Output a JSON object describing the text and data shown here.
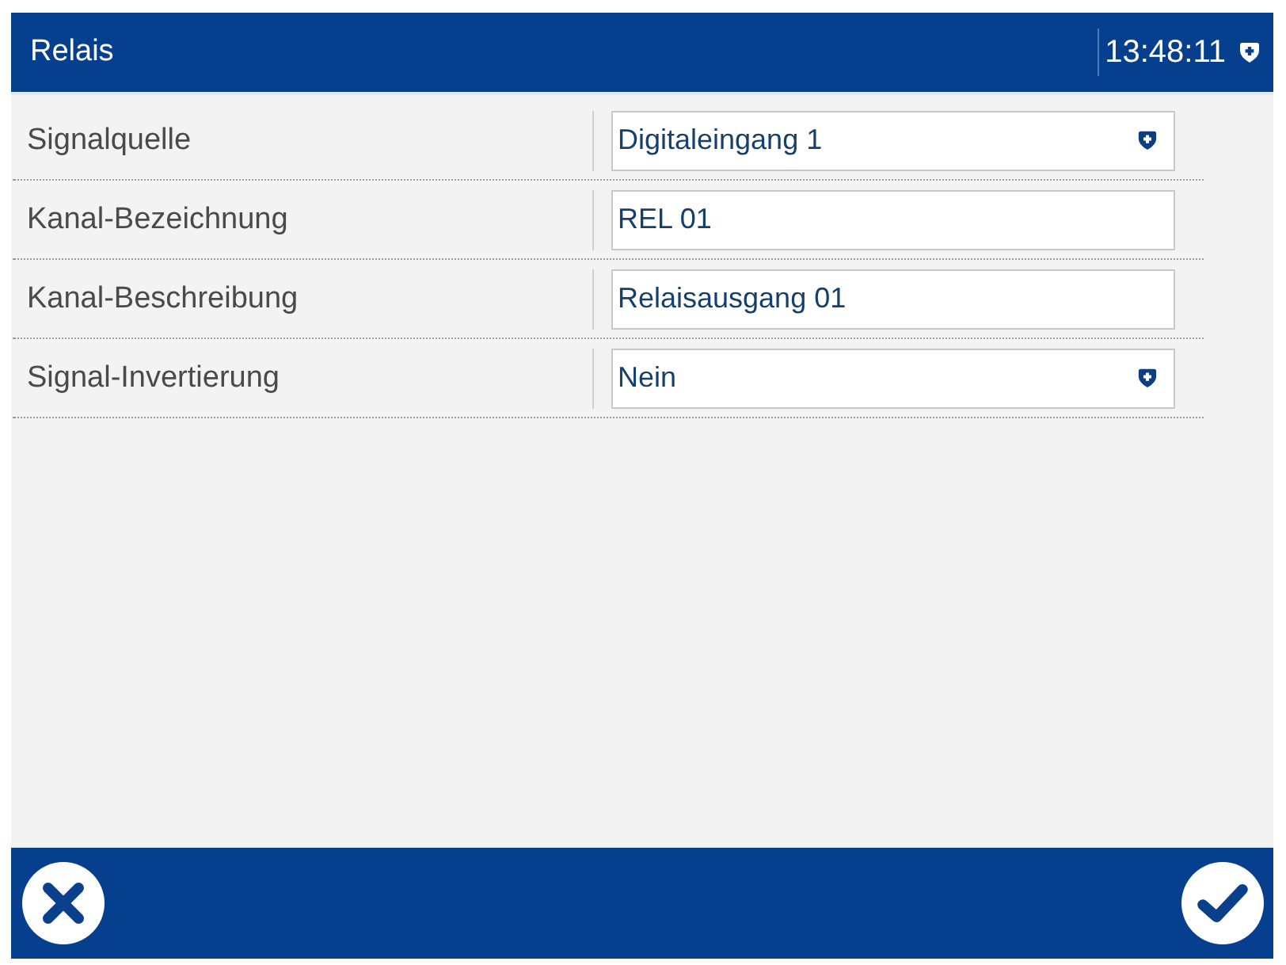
{
  "window": {
    "title": "Relais",
    "time": "13:48:11"
  },
  "fields": [
    {
      "label": "Signalquelle",
      "kind": "dropdown",
      "value": "Digitaleingang 1"
    },
    {
      "label": "Kanal-Bezeichnung",
      "kind": "text",
      "value": "REL 01"
    },
    {
      "label": "Kanal-Beschreibung",
      "kind": "text",
      "value": "Relaisausgang 01"
    },
    {
      "label": "Signal-Invertierung",
      "kind": "dropdown",
      "value": "Nein"
    }
  ]
}
